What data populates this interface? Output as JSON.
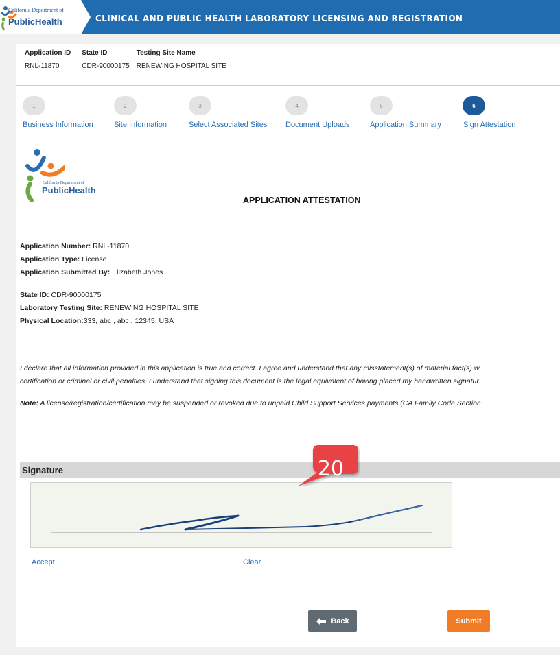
{
  "header": {
    "logo_small": "California Department of",
    "logo_big": "PublicHealth",
    "title": "CLINICAL AND PUBLIC HEALTH LABORATORY LICENSING AND REGISTRATION"
  },
  "app_info": {
    "application_id_label": "Application ID",
    "application_id": "RNL-11870",
    "state_id_label": "State ID",
    "state_id": "CDR-90000175",
    "site_name_label": "Testing Site Name",
    "site_name": "RENEWING HOSPITAL SITE"
  },
  "steps": [
    {
      "number": "1",
      "label": "Business Information"
    },
    {
      "number": "2",
      "label": "Site Information"
    },
    {
      "number": "3",
      "label": "Select Associated Sites"
    },
    {
      "number": "4",
      "label": "Document Uploads"
    },
    {
      "number": "5",
      "label": "Application Summary"
    },
    {
      "number": "6",
      "label": "Sign Attestation"
    }
  ],
  "document": {
    "logo_small": "California Department of",
    "logo_big": "PublicHealth",
    "title": "APPLICATION ATTESTATION",
    "app_number_label": "Application Number:",
    "app_number": " RNL-11870",
    "app_type_label": "Application Type:",
    "app_type": " License",
    "submitted_by_label": "Application Submitted By:",
    "submitted_by": " Elizabeth Jones",
    "state_id_label": "State ID:",
    "state_id": " CDR-90000175",
    "testing_site_label": "Laboratory Testing Site:",
    "testing_site": " RENEWING HOSPITAL SITE",
    "location_label": "Physical Location:",
    "location": "333, abc , abc , 12345, USA",
    "declaration_line1": "I declare that all information provided in this application is true and correct. I agree and understand that any misstatement(s) of material fact(s) w",
    "declaration_line2": "certification or criminal or civil penalties. I understand that signing this document is the legal equivalent of having placed my handwritten signatur",
    "note_label": "Note:",
    "note_text": " A license/registration/certification may be suspended or revoked due to unpaid Child Support Services payments (CA Family Code Section"
  },
  "signature": {
    "title": "Signature",
    "accept": "Accept",
    "clear": "Clear"
  },
  "callout": {
    "number": "20"
  },
  "buttons": {
    "back": "Back",
    "submit": "Submit"
  },
  "colors": {
    "header": "#1f6db0",
    "active_step": "#1e5a99",
    "submit": "#f07c25",
    "back": "#5f6a72",
    "link": "#2a6db0",
    "callout": "#e84347"
  }
}
